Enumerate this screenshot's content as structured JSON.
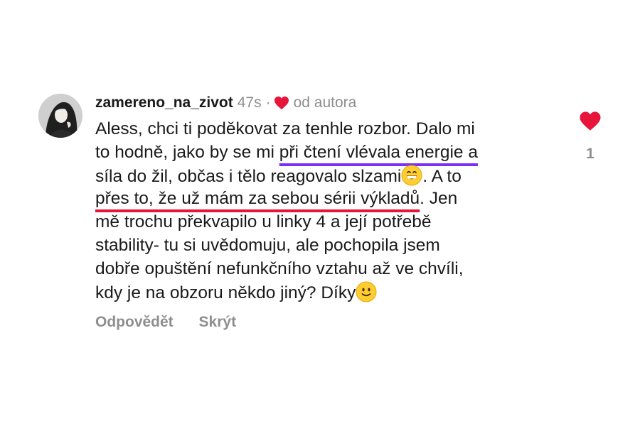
{
  "comment": {
    "username": "zamereno_na_zivot",
    "time": "47s",
    "separator": "·",
    "author_like_label": "od autora",
    "lines": [
      {
        "parts": [
          {
            "text": "Aless, chci ti poděkovat za tenhle rozbor. Dalo mi"
          }
        ]
      },
      {
        "parts": [
          {
            "text": "to hodně, jako by se mi "
          },
          {
            "text": "při čtení vlévala energie a",
            "highlight": "purple"
          }
        ]
      },
      {
        "parts": [
          {
            "text": "síla do žil, občas i tělo reagovalo slzami"
          },
          {
            "emoji": "grinning-face-emoji"
          },
          {
            "text": ". A to"
          }
        ]
      },
      {
        "parts": [
          {
            "text": "přes to, že už mám za sebou sérii výkladů",
            "highlight": "red"
          },
          {
            "text": ". Jen"
          }
        ]
      },
      {
        "parts": [
          {
            "text": "mě trochu překvapilo u linky 4 a její potřebě"
          }
        ]
      },
      {
        "parts": [
          {
            "text": "stability- tu si uvědomuju, ale pochopila jsem"
          }
        ]
      },
      {
        "parts": [
          {
            "text": "dobře opuštění nefunkčního vztahu až ve chvíli,"
          }
        ]
      },
      {
        "parts": [
          {
            "text": "kdy je na obzoru někdo jiný? Díky"
          },
          {
            "emoji": "slightly-smiling-face-emoji"
          }
        ]
      }
    ],
    "actions": {
      "reply": "Odpovědět",
      "hide": "Skrýt"
    },
    "like_count": "1"
  },
  "colors": {
    "heart": "#e8153b",
    "purple_underline": "#7b2ff7",
    "red_underline": "#e8153b",
    "muted_text": "#8e8e8e"
  },
  "icons": {
    "avatar": "avatar",
    "author_heart": "heart-icon",
    "like_heart": "heart-icon"
  }
}
